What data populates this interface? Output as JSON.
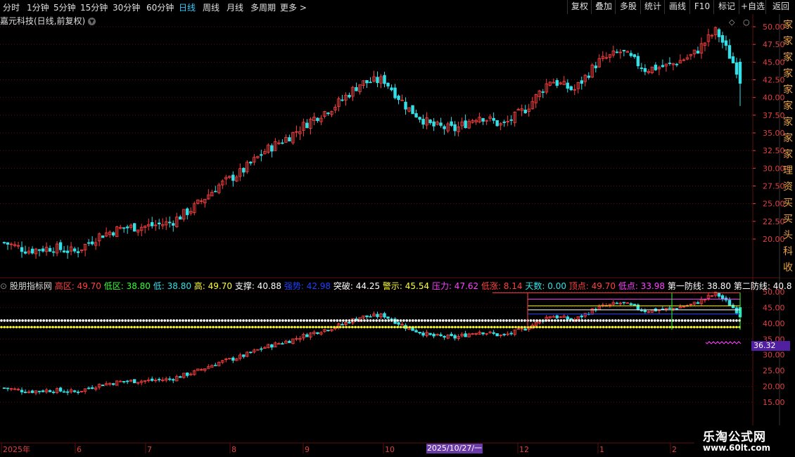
{
  "toolbar": {
    "timeframes": [
      "分时",
      "1分钟",
      "5分钟",
      "15分钟",
      "30分钟",
      "60分钟",
      "日线",
      "周线",
      "月线",
      "多周期",
      "更多 >"
    ],
    "active_timeframe": "日线",
    "right_buttons": [
      "复权",
      "叠加",
      "多股",
      "统计",
      "画线",
      "F10",
      "标记",
      "+自选",
      "返回"
    ]
  },
  "stock_title": "嘉元科技(日线,前复权)",
  "colors": {
    "up": "#ff4040",
    "down": "#33e0e8",
    "grid": "#5a1010",
    "white_band": "#ffffff",
    "yellow_band": "#ffff33"
  },
  "main_axis_ticks": [
    "50.00",
    "47.50",
    "45.00",
    "42.50",
    "40.00",
    "37.50",
    "35.00",
    "32.50",
    "30.00",
    "27.50",
    "25.00",
    "22.50",
    "20.00"
  ],
  "sub_axis_ticks": [
    "50.00",
    "45.00",
    "40.00",
    "35.00",
    "30.00",
    "25.00",
    "20.00",
    "15.00"
  ],
  "indicator": {
    "name": "股朋指标网",
    "items": [
      {
        "label": "高区: 49.70",
        "color": "#ff4040"
      },
      {
        "label": "低区: 38.80",
        "color": "#33ff33"
      },
      {
        "label": "低: 38.80",
        "color": "#33e0e8"
      },
      {
        "label": "高: 49.70",
        "color": "#ffff33"
      },
      {
        "label": "支撑: 40.88",
        "color": "#ffffff"
      },
      {
        "label": "强势: 42.98",
        "color": "#2040ff"
      },
      {
        "label": "突破: 44.25",
        "color": "#ffffff"
      },
      {
        "label": "警示: 45.54",
        "color": "#ffff33"
      },
      {
        "label": "压力: 47.62",
        "color": "#ff40ff"
      },
      {
        "label": "低涨: 8.14",
        "color": "#ff4040"
      },
      {
        "label": "天数: 0.00",
        "color": "#33e0e8"
      },
      {
        "label": "顶点: 49.70",
        "color": "#ff4040"
      },
      {
        "label": "低点: 33.98",
        "color": "#ff40ff"
      },
      {
        "label": "第一防线: 38.80",
        "color": "#ffffff"
      },
      {
        "label": "第二防线: 40.8",
        "color": "#ffffff"
      }
    ]
  },
  "sub_price_label": "36.32",
  "date_axis": {
    "labels": [
      "2025年",
      "6",
      "7",
      "8",
      "9",
      "10",
      "12",
      "1",
      "2"
    ],
    "cursor_label": "2025/10/27/一"
  },
  "right_strip_text": [
    "家",
    "家",
    "家",
    "家",
    "家",
    "家",
    "家",
    "家",
    "家",
    "理",
    "资",
    "买",
    "买",
    "头",
    "科",
    "收"
  ],
  "watermark": {
    "line1": "乐淘公式网",
    "line2": "www.60lt.com"
  },
  "chart_data": {
    "type": "candlestick",
    "title": "嘉元科技(日线,前复权)",
    "ylim": [
      17.8,
      51.5
    ],
    "approx_close_path": [
      [
        "2025-05",
        19.5
      ],
      [
        "2025-06",
        18.4
      ],
      [
        "2025-06",
        18.8
      ],
      [
        "2025-06",
        18.2
      ],
      [
        "2025-07",
        20.5
      ],
      [
        "2025-07",
        21.6
      ],
      [
        "2025-08",
        21.8
      ],
      [
        "2025-08",
        22.3
      ],
      [
        "2025-08",
        24.5
      ],
      [
        "2025-09",
        27.5
      ],
      [
        "2025-09",
        29.5
      ],
      [
        "2025-09",
        32.5
      ],
      [
        "2025-10",
        34.5
      ],
      [
        "2025-10",
        37.0
      ],
      [
        "2025-10",
        39.0
      ],
      [
        "2025-10",
        42.0
      ],
      [
        "2025-10",
        42.5
      ],
      [
        "2025-11",
        38.5
      ],
      [
        "2025-11",
        36.0
      ],
      [
        "2025-11",
        35.5
      ],
      [
        "2025-12",
        37.5
      ],
      [
        "2025-12",
        36.0
      ],
      [
        "2025-12",
        38.5
      ],
      [
        "2025-12",
        42.5
      ],
      [
        "2026-01",
        41.0
      ],
      [
        "2026-01",
        45.0
      ],
      [
        "2026-01",
        46.5
      ],
      [
        "2026-02",
        44.0
      ],
      [
        "2026-02",
        44.5
      ],
      [
        "2026-02",
        46.0
      ],
      [
        "2026-02",
        49.5
      ],
      [
        "2026-02",
        43.0
      ]
    ],
    "last_high": 49.7,
    "last_low": 38.8
  }
}
